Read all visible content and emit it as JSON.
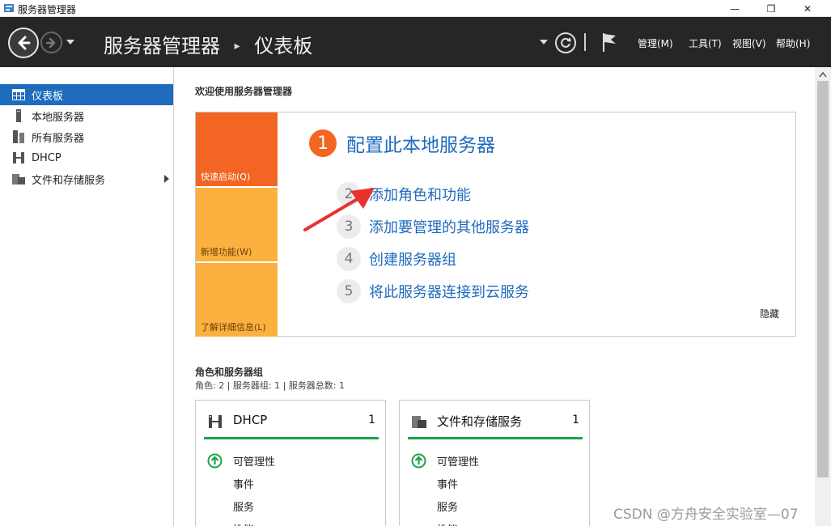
{
  "window": {
    "title": "服务器管理器",
    "min_glyph": "—",
    "max_glyph": "❐",
    "close_glyph": "✕"
  },
  "header": {
    "app_name": "服务器管理器",
    "separator": "▸",
    "current_page": "仪表板",
    "menus": [
      "管理(M)",
      "工具(T)",
      "视图(V)",
      "帮助(H)"
    ],
    "separator_glyph": "|"
  },
  "sidebar": {
    "items": [
      {
        "label": "仪表板",
        "icon": "dashboard-icon",
        "active": true
      },
      {
        "label": "本地服务器",
        "icon": "server-icon",
        "active": false
      },
      {
        "label": "所有服务器",
        "icon": "servers-icon",
        "active": false
      },
      {
        "label": "DHCP",
        "icon": "dhcp-icon",
        "active": false
      },
      {
        "label": "文件和存储服务",
        "icon": "storage-icon",
        "active": false,
        "has_submenu": true
      }
    ]
  },
  "main": {
    "welcome_title": "欢迎使用服务器管理器",
    "quick_start": {
      "tiles": [
        "快速启动(Q)",
        "新增功能(W)",
        "了解详细信息(L)"
      ],
      "steps": [
        {
          "num": "1",
          "label": "配置此本地服务器"
        },
        {
          "num": "2",
          "label": "添加角色和功能"
        },
        {
          "num": "3",
          "label": "添加要管理的其他服务器"
        },
        {
          "num": "4",
          "label": "创建服务器组"
        },
        {
          "num": "5",
          "label": "将此服务器连接到云服务"
        }
      ],
      "hide_label": "隐藏"
    },
    "roles": {
      "title": "角色和服务器组",
      "summary": "角色: 2 | 服务器组: 1 | 服务器总数: 1",
      "cards": [
        {
          "name": "DHCP",
          "count": "1",
          "icon": "dhcp-icon",
          "rows": [
            "可管理性",
            "事件",
            "服务",
            "性能"
          ]
        },
        {
          "name": "文件和存储服务",
          "count": "1",
          "icon": "storage-icon",
          "rows": [
            "可管理性",
            "事件",
            "服务",
            "性能"
          ]
        }
      ]
    }
  },
  "watermark": "CSDN @方舟安全实验室—07",
  "colors": {
    "header_bg": "#262626",
    "active_blue": "#1f6bbd",
    "tile_orange": "#f26522",
    "tile_amber": "#fbb040",
    "status_green": "#1aa34a",
    "annotation_red": "#e8312f"
  }
}
